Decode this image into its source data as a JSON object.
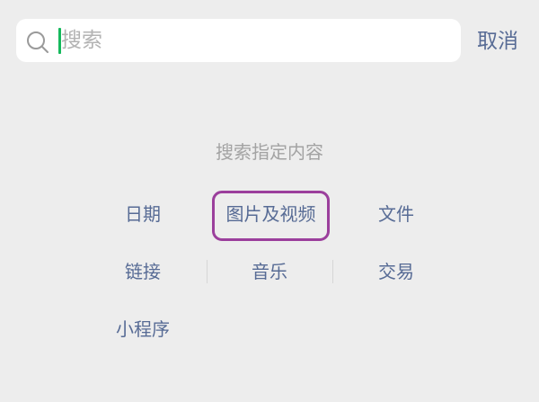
{
  "search": {
    "placeholder": "搜索",
    "icon": "search-icon"
  },
  "cancel_label": "取消",
  "section_title": "搜索指定内容",
  "filters": [
    {
      "label": "日期"
    },
    {
      "label": "图片及视频",
      "highlighted": true
    },
    {
      "label": "文件"
    },
    {
      "label": "链接"
    },
    {
      "label": "音乐"
    },
    {
      "label": "交易"
    },
    {
      "label": "小程序"
    }
  ],
  "colors": {
    "background": "#ededed",
    "search_box": "#ffffff",
    "accent_link": "#576b95",
    "caret": "#15b95c",
    "highlight_frame": "#9b3f9c",
    "muted_text": "#a3a3a3"
  }
}
